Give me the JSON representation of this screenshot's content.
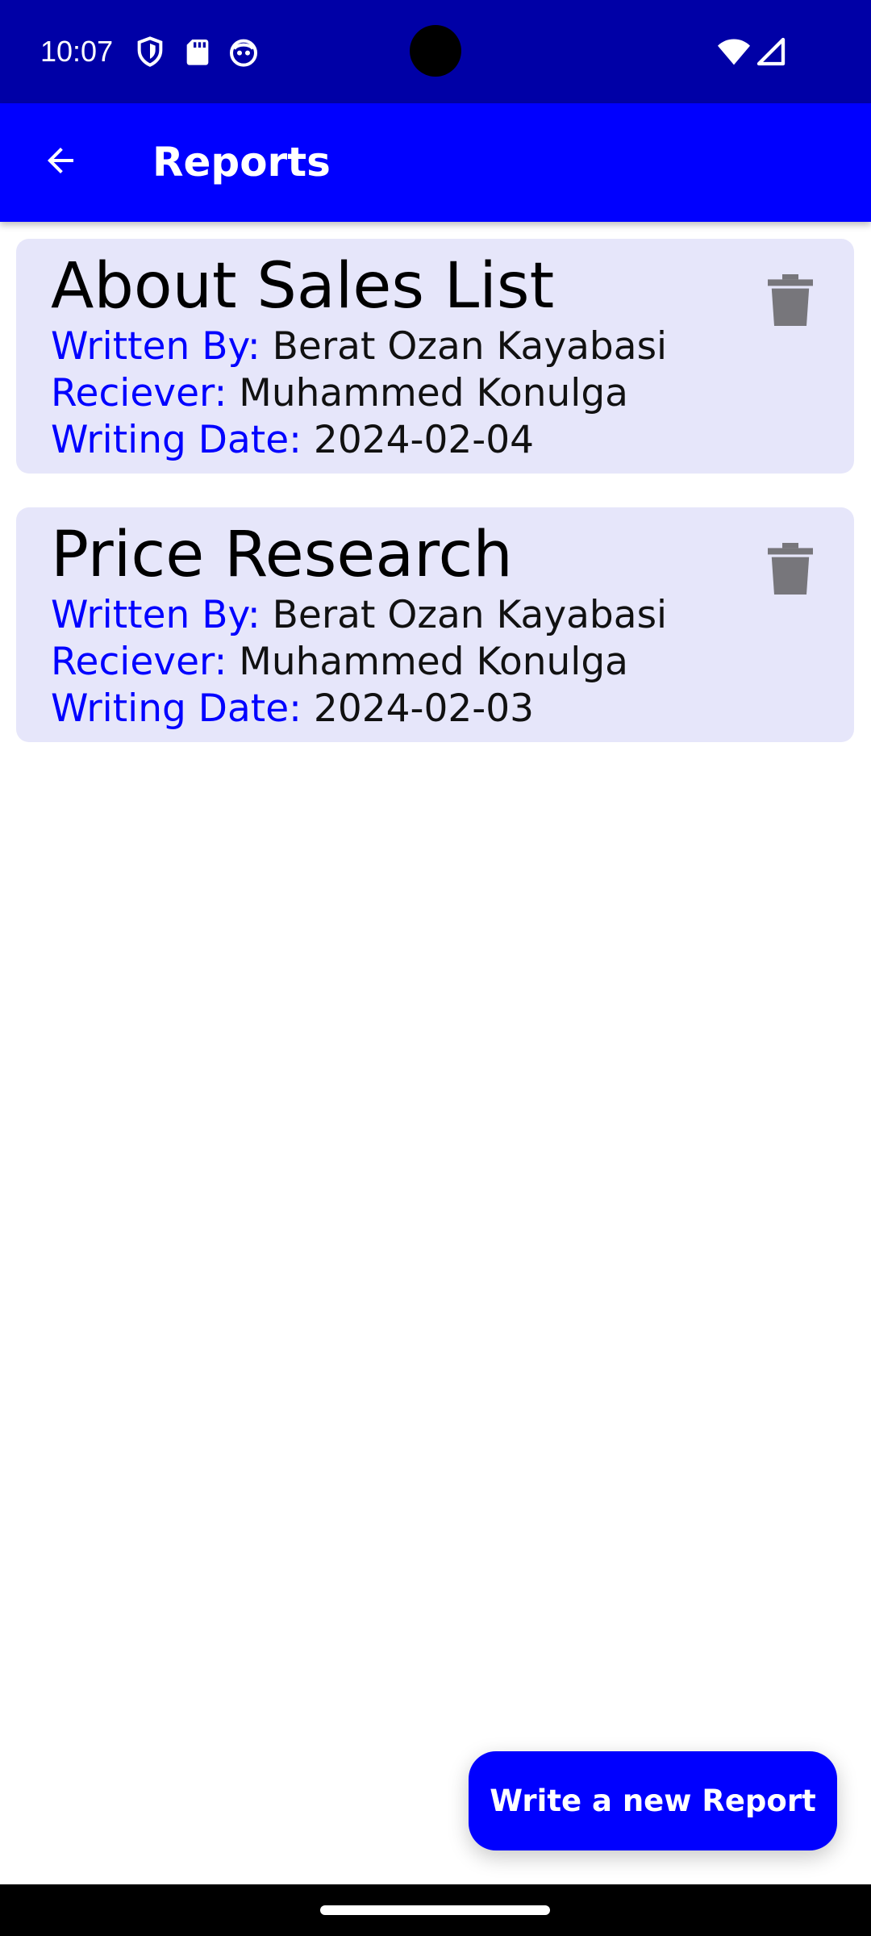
{
  "status_bar": {
    "time": "10:07",
    "icons": [
      "shield-icon",
      "sd-card-icon",
      "robot-face-icon",
      "wifi-icon",
      "cell-signal-icon"
    ]
  },
  "app_bar": {
    "title": "Reports",
    "back_icon": "arrow-left-icon"
  },
  "reports": [
    {
      "title": "About Sales List",
      "written_by_label": "Written By:",
      "written_by": "Berat Ozan Kayabasi",
      "receiver_label": "Reciever:",
      "receiver": "Muhammed Konulga",
      "date_label": "Writing Date:",
      "date": "2024-02-04"
    },
    {
      "title": "Price Research",
      "written_by_label": "Written By:",
      "written_by": "Berat Ozan Kayabasi",
      "receiver_label": "Reciever:",
      "receiver": "Muhammed Konulga",
      "date_label": "Writing Date:",
      "date": "2024-02-03"
    }
  ],
  "fab": {
    "label": "Write a new Report"
  },
  "colors": {
    "status_bar": "#0000a6",
    "app_bar": "#0000ff",
    "card_background": "#e6e6fa",
    "label_accent": "#0000ff",
    "trash_icon": "#77767b"
  }
}
